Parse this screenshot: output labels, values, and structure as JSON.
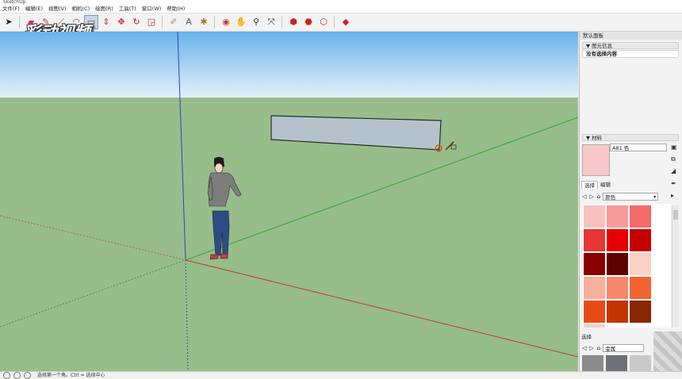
{
  "menu": [
    "文件(F)",
    "编辑(E)",
    "视图(V)",
    "相机(C)",
    "绘图(R)",
    "工具(T)",
    "窗口(W)",
    "帮助(H)"
  ],
  "watermark": "彩动视频",
  "toolbar_icons": [
    "select-icon",
    "eraser-icon",
    "paint-icon",
    "line-icon",
    "arc-icon",
    "rectangle-icon",
    "push-pull-icon",
    "move-icon",
    "rotate-icon",
    "scale-icon",
    "tape-icon",
    "text-icon",
    "axes-icon",
    "orbit-icon",
    "pan-icon",
    "zoom-icon",
    "zoom-extents-icon",
    "warehouse-icon",
    "extension-icon",
    "model-icon",
    "send-icon"
  ],
  "panel": {
    "title": "默认面板",
    "entity_info": {
      "header": "图元信息",
      "body": "没有选择内容"
    },
    "materials": {
      "header": "材料",
      "material_name": "A81 色",
      "tab_select": "选择",
      "tab_edit": "编辑",
      "library": "颜色",
      "swatches": [
        "#f9c0c0",
        "#f69a9a",
        "#f26a6a",
        "#e83535",
        "#e60000",
        "#c40000",
        "#8a0000",
        "#5e0000",
        "#fbd1c4",
        "#f9b09a",
        "#f6896c",
        "#f2642f",
        "#e84a16",
        "#c43400",
        "#8a2600",
        "#f4d0c8"
      ],
      "select2_label": "选择",
      "select2_library": "金属",
      "select2_swatches": [
        "#8c8c8c",
        "#6e7276",
        "#c9c9c9"
      ]
    }
  },
  "status": {
    "text": "选择第一个角。Ctrl = 选择中心"
  }
}
